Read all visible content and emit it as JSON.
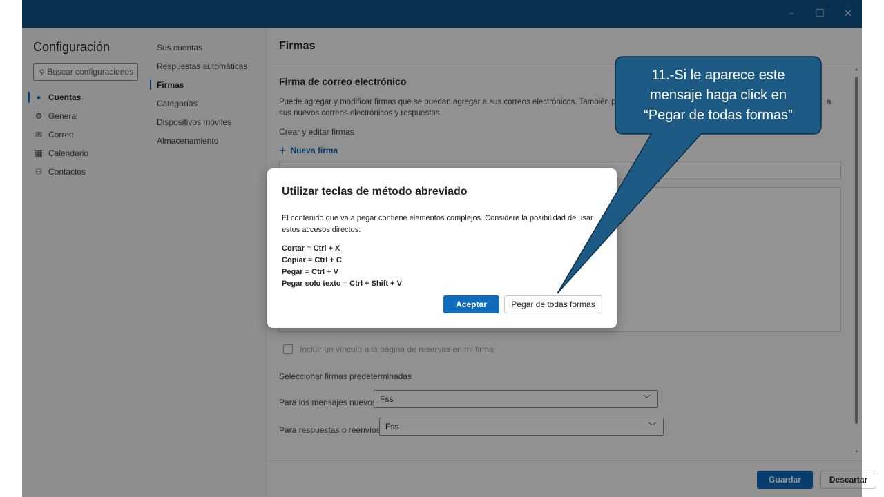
{
  "window": {
    "controls": [
      "–",
      "❐",
      "✕"
    ]
  },
  "nav": {
    "title": "Configuración",
    "search_placeholder": "Buscar configuraciones",
    "items": [
      {
        "label": "Cuentas",
        "icon": "person-icon"
      },
      {
        "label": "General",
        "icon": "gear-icon"
      },
      {
        "label": "Correo",
        "icon": "mail-icon"
      },
      {
        "label": "Calendario",
        "icon": "calendar-icon"
      },
      {
        "label": "Contactos",
        "icon": "people-icon"
      }
    ]
  },
  "subnav": {
    "items": [
      {
        "label": "Sus cuentas"
      },
      {
        "label": "Respuestas automáticas"
      },
      {
        "label": "Firmas"
      },
      {
        "label": "Categorías"
      },
      {
        "label": "Dispositivos móviles"
      },
      {
        "label": "Almacenamiento"
      }
    ]
  },
  "main": {
    "title": "Firmas",
    "section_title": "Firma de correo electrónico",
    "description": "Puede agregar y modificar firmas que se puedan agregar a sus correos electrónicos. También p",
    "description_tail": "a",
    "description_line2": "sus nuevos correos electrónicos y respuestas.",
    "create_label": "Crear y editar firmas",
    "new_signature": "Nueva firma",
    "booking_link_label": "Incluir un vínculo a la página de reservas en mi firma",
    "default_sig_label": "Seleccionar firmas predeterminadas",
    "new_messages_label": "Para los mensajes nuevos:",
    "new_messages_value": "Fss",
    "replies_label": "Para respuestas o reenvíos :",
    "replies_value": "Fss",
    "save": "Guardar",
    "discard": "Descartar"
  },
  "dialog": {
    "title": "Utilizar teclas de método abreviado",
    "body": "El contenido que va a pegar contiene elementos complejos. Considere la posibilidad de usar estos accesos directos:",
    "shortcuts": [
      {
        "name": "Cortar",
        "keys": "Ctrl + X"
      },
      {
        "name": "Copiar",
        "keys": "Ctrl + C"
      },
      {
        "name": "Pegar",
        "keys": "Ctrl + V"
      },
      {
        "name": "Pegar solo texto",
        "keys": "Ctrl + Shift + V"
      }
    ],
    "accept": "Aceptar",
    "paste_anyway": "Pegar de todas formas"
  },
  "callout": {
    "line1": "11.-Si le aparece este",
    "line2": "mensaje haga click en",
    "line3": "“Pegar de todas formas”",
    "fill": "#1d5b85"
  }
}
